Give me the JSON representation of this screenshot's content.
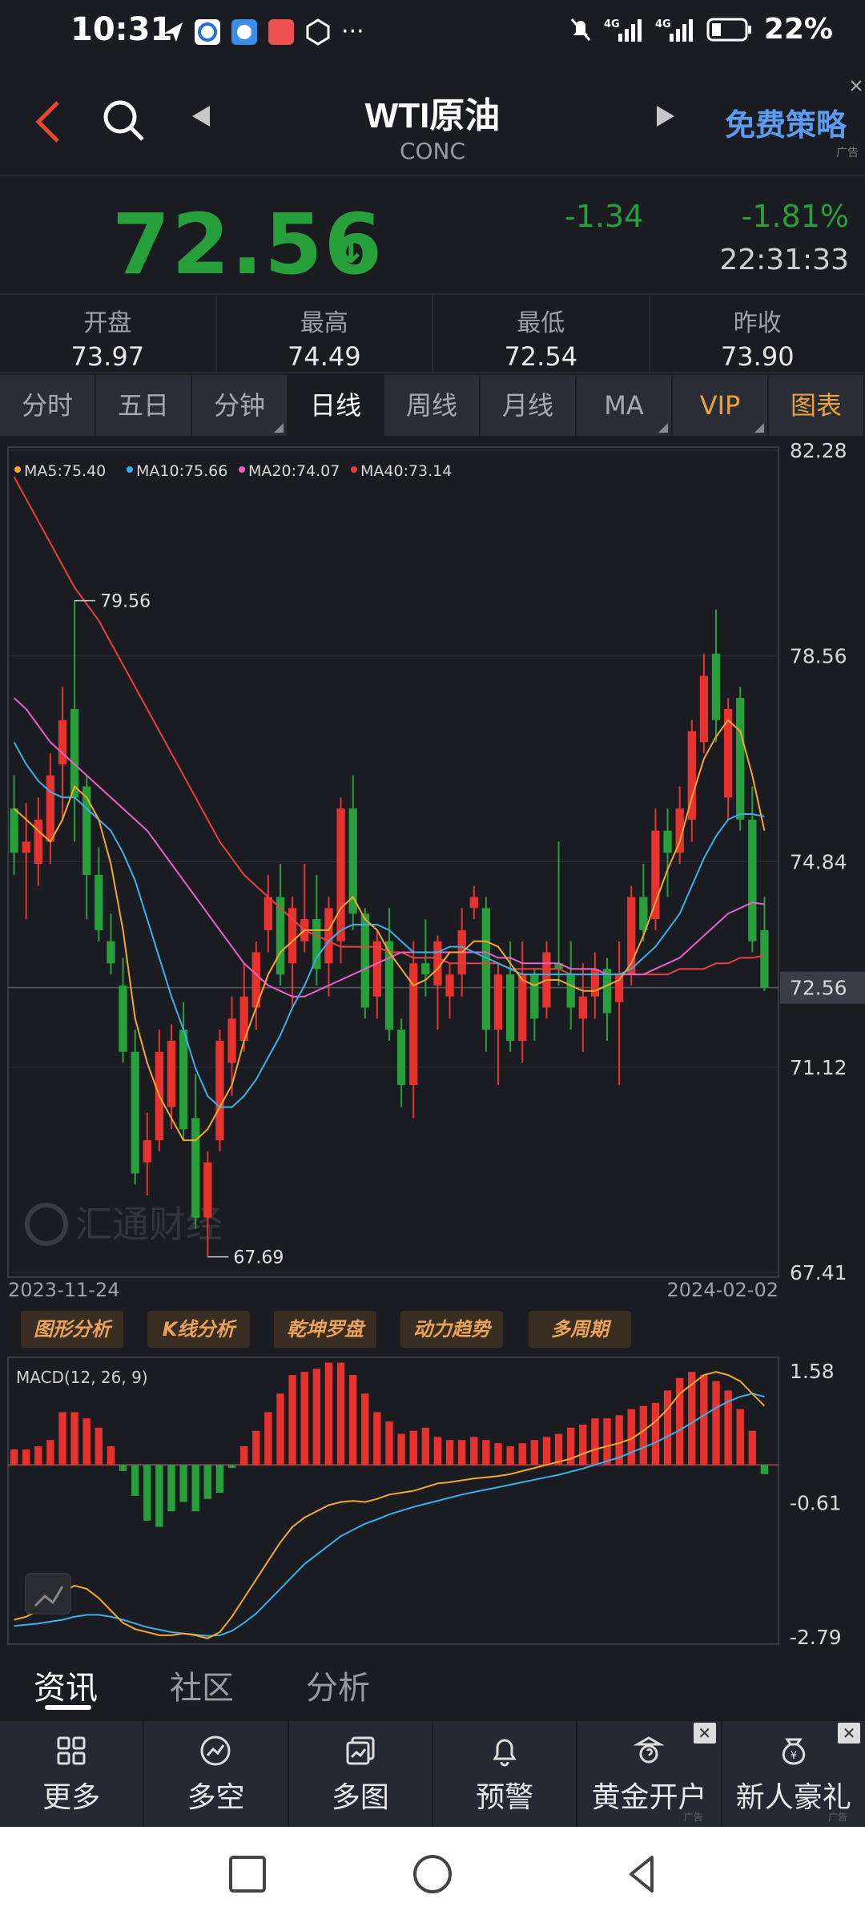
{
  "status_bar": {
    "time": "10:31",
    "battery": "22%",
    "more": "···"
  },
  "header": {
    "title": "WTI原油",
    "subtitle": "CONC",
    "promo": "免费策略",
    "promo_ad": "广告"
  },
  "quote": {
    "price": "72.56",
    "price_arrow": "↓",
    "change": "-1.34",
    "change_pct": "-1.81%",
    "time": "22:31:33",
    "down_color": "#27a03b"
  },
  "stats": [
    {
      "label": "开盘",
      "value": "73.97"
    },
    {
      "label": "最高",
      "value": "74.49"
    },
    {
      "label": "最低",
      "value": "72.54"
    },
    {
      "label": "昨收",
      "value": "73.90"
    }
  ],
  "tabs": [
    "分时",
    "五日",
    "分钟",
    "日线",
    "周线",
    "月线",
    "MA",
    "VIP",
    "图表"
  ],
  "active_tab": "日线",
  "chart": {
    "legend": [
      {
        "label": "MA5:75.40",
        "color": "#f0a830"
      },
      {
        "label": "MA10:75.66",
        "color": "#3ab0e8"
      },
      {
        "label": "MA20:74.07",
        "color": "#e860c8"
      },
      {
        "label": "MA40:73.14",
        "color": "#e84040"
      }
    ],
    "y_ticks": [
      "82.28",
      "78.56",
      "74.84",
      "72.56",
      "71.12",
      "67.41"
    ],
    "high_label": "79.56",
    "low_label": "67.69",
    "date_start": "2023-11-24",
    "date_end": "2024-02-02",
    "watermark": "汇通财经",
    "up_color": "#e8322e",
    "down_color": "#27a03b"
  },
  "analysis_buttons": [
    "图形分析",
    "K线分析",
    "乾坤罗盘",
    "动力趋势",
    "多周期"
  ],
  "macd": {
    "label": "MACD(12, 26, 9)",
    "y_ticks": [
      "1.58",
      "-0.61",
      "-2.79"
    ]
  },
  "content_tabs": [
    "资讯",
    "社区",
    "分析"
  ],
  "toolbar": [
    {
      "label": "更多",
      "icon": "grid-icon"
    },
    {
      "label": "多空",
      "icon": "trend-icon"
    },
    {
      "label": "多图",
      "icon": "multi-chart-icon"
    },
    {
      "label": "预警",
      "icon": "bell-icon"
    },
    {
      "label": "黄金开户",
      "icon": "gold-icon",
      "ad": "广告"
    },
    {
      "label": "新人豪礼",
      "icon": "gift-bag-icon",
      "ad": "广告"
    }
  ],
  "chart_data": {
    "type": "candlestick",
    "ohlc": [
      [
        75.8,
        76.4,
        74.6,
        75.0
      ],
      [
        75.0,
        75.9,
        73.8,
        75.2
      ],
      [
        74.8,
        76.0,
        74.4,
        75.6
      ],
      [
        75.2,
        76.8,
        74.8,
        76.4
      ],
      [
        76.6,
        78.0,
        75.6,
        77.4
      ],
      [
        77.6,
        79.56,
        75.2,
        76.0
      ],
      [
        76.2,
        76.4,
        73.8,
        74.6
      ],
      [
        74.6,
        75.1,
        73.4,
        73.6
      ],
      [
        73.4,
        73.9,
        72.8,
        73.0
      ],
      [
        72.6,
        73.1,
        71.2,
        71.4
      ],
      [
        71.4,
        71.8,
        69.0,
        69.2
      ],
      [
        69.4,
        70.3,
        68.8,
        69.8
      ],
      [
        69.8,
        71.8,
        69.6,
        71.4
      ],
      [
        70.4,
        71.9,
        70.0,
        71.6
      ],
      [
        71.8,
        72.3,
        69.8,
        70.0
      ],
      [
        70.2,
        71.0,
        68.2,
        68.4
      ],
      [
        68.4,
        69.6,
        67.69,
        69.4
      ],
      [
        69.8,
        71.8,
        69.6,
        71.6
      ],
      [
        71.2,
        72.4,
        70.6,
        72.0
      ],
      [
        71.6,
        73.0,
        71.4,
        72.4
      ],
      [
        72.2,
        73.4,
        71.8,
        73.2
      ],
      [
        73.6,
        74.6,
        73.2,
        74.2
      ],
      [
        74.2,
        74.8,
        72.6,
        72.8
      ],
      [
        73.0,
        74.2,
        72.2,
        74.0
      ],
      [
        73.4,
        74.8,
        73.2,
        73.8
      ],
      [
        73.8,
        74.6,
        72.6,
        72.9
      ],
      [
        73.0,
        74.2,
        72.4,
        74.0
      ],
      [
        73.4,
        76.0,
        73.0,
        75.8
      ],
      [
        75.8,
        76.4,
        73.6,
        73.9
      ],
      [
        73.9,
        74.0,
        72.0,
        72.2
      ],
      [
        72.4,
        73.6,
        72.0,
        73.4
      ],
      [
        73.4,
        74.0,
        71.6,
        71.8
      ],
      [
        71.8,
        72.0,
        70.4,
        70.8
      ],
      [
        70.8,
        73.4,
        70.2,
        73.0
      ],
      [
        73.0,
        73.8,
        72.4,
        72.8
      ],
      [
        72.6,
        73.5,
        71.8,
        73.4
      ],
      [
        72.4,
        73.0,
        72.0,
        72.8
      ],
      [
        72.8,
        74.0,
        72.4,
        73.6
      ],
      [
        74.0,
        74.4,
        73.8,
        74.2
      ],
      [
        74.0,
        74.2,
        71.4,
        71.8
      ],
      [
        71.8,
        73.0,
        70.8,
        72.8
      ],
      [
        72.8,
        73.4,
        71.4,
        71.6
      ],
      [
        71.6,
        73.4,
        71.2,
        72.8
      ],
      [
        72.8,
        72.9,
        71.6,
        72.0
      ],
      [
        72.2,
        73.4,
        72.0,
        73.2
      ],
      [
        73.0,
        75.2,
        72.6,
        72.9
      ],
      [
        72.8,
        73.4,
        71.8,
        72.2
      ],
      [
        72.0,
        73.0,
        71.4,
        72.4
      ],
      [
        72.4,
        73.2,
        72.0,
        72.9
      ],
      [
        72.9,
        73.1,
        71.6,
        72.1
      ],
      [
        72.3,
        73.4,
        70.8,
        72.8
      ],
      [
        72.8,
        74.4,
        72.6,
        74.2
      ],
      [
        74.2,
        74.8,
        73.4,
        73.6
      ],
      [
        73.8,
        75.8,
        73.6,
        75.4
      ],
      [
        75.4,
        75.8,
        74.2,
        75.0
      ],
      [
        75.0,
        76.2,
        74.8,
        75.8
      ],
      [
        75.6,
        77.4,
        75.2,
        77.2
      ],
      [
        77.0,
        78.6,
        76.8,
        78.2
      ],
      [
        78.6,
        79.4,
        77.0,
        77.4
      ],
      [
        76.0,
        77.8,
        75.6,
        77.6
      ],
      [
        77.8,
        78.0,
        75.4,
        75.6
      ],
      [
        75.6,
        76.2,
        73.2,
        73.4
      ],
      [
        73.6,
        74.2,
        72.5,
        72.56
      ]
    ],
    "ma5": [
      75.8,
      75.6,
      75.4,
      75.2,
      75.6,
      76.2,
      76.0,
      75.6,
      74.8,
      73.6,
      72.0,
      71.2,
      70.6,
      70.2,
      69.8,
      69.8,
      70.0,
      70.4,
      70.8,
      71.6,
      72.2,
      72.8,
      73.2,
      73.4,
      73.6,
      73.6,
      73.6,
      74.0,
      74.2,
      73.8,
      73.6,
      73.2,
      72.9,
      72.6,
      72.7,
      72.9,
      73.2,
      73.2,
      73.4,
      73.4,
      73.3,
      73.0,
      72.7,
      72.6,
      72.7,
      72.7,
      72.6,
      72.5,
      72.5,
      72.6,
      72.7,
      73.0,
      73.5,
      74.1,
      74.7,
      75.2,
      76.0,
      76.7,
      77.1,
      77.4,
      77.2,
      76.4,
      75.4
    ],
    "ma10": [
      77.0,
      76.6,
      76.3,
      76.1,
      76.0,
      76.0,
      75.8,
      75.6,
      75.4,
      75.0,
      74.5,
      73.8,
      73.1,
      72.4,
      71.8,
      71.1,
      70.6,
      70.4,
      70.4,
      70.6,
      70.9,
      71.3,
      71.7,
      72.2,
      72.6,
      73.1,
      73.4,
      73.6,
      73.7,
      73.7,
      73.7,
      73.6,
      73.4,
      73.2,
      73.2,
      73.2,
      73.3,
      73.3,
      73.2,
      73.1,
      73.0,
      72.9,
      72.8,
      72.8,
      72.8,
      72.8,
      72.8,
      72.8,
      72.8,
      72.8,
      72.8,
      72.9,
      73.1,
      73.3,
      73.6,
      73.9,
      74.4,
      74.9,
      75.3,
      75.6,
      75.7,
      75.7,
      75.66
    ],
    "ma20": [
      77.8,
      77.6,
      77.3,
      77.0,
      76.8,
      76.6,
      76.4,
      76.2,
      76.0,
      75.8,
      75.6,
      75.4,
      75.1,
      74.8,
      74.5,
      74.2,
      73.9,
      73.6,
      73.3,
      73.0,
      72.8,
      72.6,
      72.5,
      72.4,
      72.4,
      72.5,
      72.6,
      72.7,
      72.8,
      72.9,
      73.0,
      73.1,
      73.2,
      73.2,
      73.2,
      73.2,
      73.2,
      73.2,
      73.2,
      73.2,
      73.1,
      73.1,
      73.0,
      73.0,
      73.0,
      73.0,
      72.9,
      72.9,
      72.9,
      72.8,
      72.8,
      72.8,
      72.8,
      72.9,
      73.0,
      73.1,
      73.3,
      73.5,
      73.7,
      73.9,
      74.0,
      74.1,
      74.07
    ],
    "ma40": [
      81.8,
      81.4,
      81.0,
      80.6,
      80.2,
      79.8,
      79.5,
      79.2,
      78.8,
      78.4,
      78.0,
      77.6,
      77.2,
      76.8,
      76.4,
      76.0,
      75.6,
      75.2,
      74.9,
      74.6,
      74.4,
      74.2,
      74.0,
      73.8,
      73.6,
      73.5,
      73.4,
      73.3,
      73.3,
      73.3,
      73.3,
      73.2,
      73.2,
      73.1,
      73.1,
      73.1,
      73.0,
      73.0,
      73.0,
      73.0,
      73.0,
      72.9,
      72.9,
      72.9,
      72.9,
      72.9,
      72.8,
      72.8,
      72.8,
      72.8,
      72.8,
      72.8,
      72.8,
      72.8,
      72.8,
      72.9,
      72.9,
      72.9,
      73.0,
      73.0,
      73.1,
      73.1,
      73.14
    ],
    "ylim": [
      67.41,
      82.28
    ],
    "macd_hist": [
      0.25,
      0.25,
      0.3,
      0.4,
      0.85,
      0.85,
      0.75,
      0.6,
      0.3,
      -0.1,
      -0.5,
      -0.9,
      -1.0,
      -0.75,
      -0.6,
      -0.75,
      -0.55,
      -0.45,
      -0.05,
      0.3,
      0.55,
      0.85,
      1.15,
      1.45,
      1.5,
      1.55,
      1.65,
      1.65,
      1.45,
      1.15,
      0.85,
      0.7,
      0.5,
      0.55,
      0.6,
      0.45,
      0.4,
      0.4,
      0.45,
      0.4,
      0.35,
      0.3,
      0.35,
      0.4,
      0.45,
      0.5,
      0.6,
      0.65,
      0.75,
      0.75,
      0.8,
      0.9,
      0.95,
      1.0,
      1.2,
      1.4,
      1.5,
      1.45,
      1.35,
      1.2,
      0.9,
      0.55,
      -0.15
    ],
    "macd_dif": [
      -2.5,
      -2.45,
      -2.35,
      -2.2,
      -2.05,
      -1.95,
      -2.0,
      -2.15,
      -2.35,
      -2.55,
      -2.65,
      -2.7,
      -2.75,
      -2.75,
      -2.72,
      -2.75,
      -2.8,
      -2.7,
      -2.45,
      -2.15,
      -1.85,
      -1.55,
      -1.25,
      -1.0,
      -0.85,
      -0.75,
      -0.65,
      -0.6,
      -0.58,
      -0.6,
      -0.55,
      -0.48,
      -0.45,
      -0.42,
      -0.36,
      -0.3,
      -0.28,
      -0.25,
      -0.22,
      -0.2,
      -0.18,
      -0.15,
      -0.1,
      -0.05,
      0.0,
      0.05,
      0.1,
      0.18,
      0.25,
      0.3,
      0.35,
      0.42,
      0.55,
      0.7,
      0.9,
      1.15,
      1.3,
      1.45,
      1.5,
      1.45,
      1.35,
      1.15,
      0.95
    ],
    "macd_dea": [
      -2.6,
      -2.58,
      -2.56,
      -2.53,
      -2.5,
      -2.45,
      -2.42,
      -2.42,
      -2.45,
      -2.5,
      -2.56,
      -2.62,
      -2.66,
      -2.7,
      -2.72,
      -2.74,
      -2.76,
      -2.75,
      -2.68,
      -2.55,
      -2.4,
      -2.2,
      -2.0,
      -1.8,
      -1.6,
      -1.45,
      -1.3,
      -1.15,
      -1.05,
      -0.95,
      -0.88,
      -0.8,
      -0.74,
      -0.68,
      -0.63,
      -0.58,
      -0.53,
      -0.48,
      -0.44,
      -0.4,
      -0.36,
      -0.32,
      -0.28,
      -0.24,
      -0.2,
      -0.16,
      -0.11,
      -0.06,
      0.0,
      0.06,
      0.12,
      0.2,
      0.28,
      0.36,
      0.46,
      0.56,
      0.68,
      0.8,
      0.92,
      1.02,
      1.1,
      1.15,
      1.1
    ],
    "macd_ylim": [
      -2.79,
      1.58
    ]
  }
}
